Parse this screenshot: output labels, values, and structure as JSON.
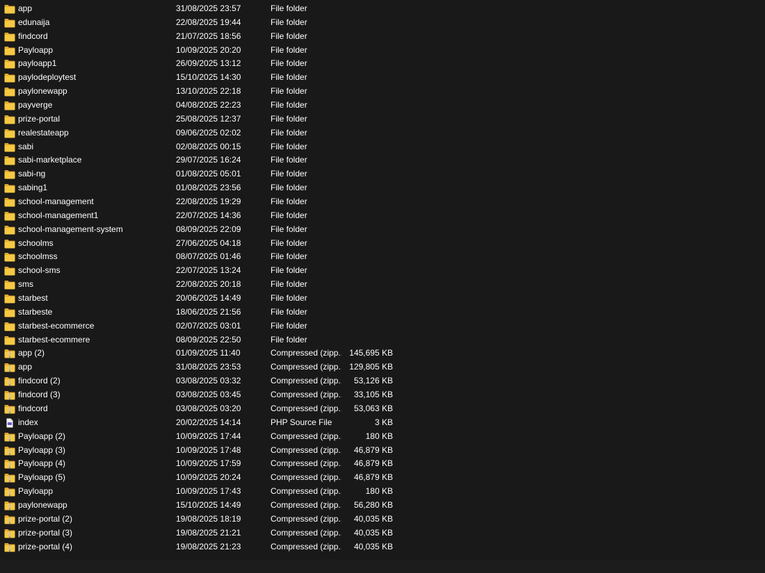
{
  "file_list": {
    "rows": [
      {
        "name": "app",
        "date": "31/08/2025 23:57",
        "type": "File folder",
        "size": "",
        "icon": "folder-icon"
      },
      {
        "name": "edunaija",
        "date": "22/08/2025 19:44",
        "type": "File folder",
        "size": "",
        "icon": "folder-icon"
      },
      {
        "name": "findcord",
        "date": "21/07/2025 18:56",
        "type": "File folder",
        "size": "",
        "icon": "folder-icon"
      },
      {
        "name": "Payloapp",
        "date": "10/09/2025 20:20",
        "type": "File folder",
        "size": "",
        "icon": "folder-icon"
      },
      {
        "name": "payloapp1",
        "date": "26/09/2025 13:12",
        "type": "File folder",
        "size": "",
        "icon": "folder-icon"
      },
      {
        "name": "paylodeploytest",
        "date": "15/10/2025 14:30",
        "type": "File folder",
        "size": "",
        "icon": "folder-icon"
      },
      {
        "name": "paylonewapp",
        "date": "13/10/2025 22:18",
        "type": "File folder",
        "size": "",
        "icon": "folder-icon"
      },
      {
        "name": "payverge",
        "date": "04/08/2025 22:23",
        "type": "File folder",
        "size": "",
        "icon": "folder-icon"
      },
      {
        "name": "prize-portal",
        "date": "25/08/2025 12:37",
        "type": "File folder",
        "size": "",
        "icon": "folder-icon"
      },
      {
        "name": "realestateapp",
        "date": "09/06/2025 02:02",
        "type": "File folder",
        "size": "",
        "icon": "folder-icon"
      },
      {
        "name": "sabi",
        "date": "02/08/2025 00:15",
        "type": "File folder",
        "size": "",
        "icon": "folder-icon"
      },
      {
        "name": "sabi-marketplace",
        "date": "29/07/2025 16:24",
        "type": "File folder",
        "size": "",
        "icon": "folder-icon"
      },
      {
        "name": "sabi-ng",
        "date": "01/08/2025 05:01",
        "type": "File folder",
        "size": "",
        "icon": "folder-icon"
      },
      {
        "name": "sabing1",
        "date": "01/08/2025 23:56",
        "type": "File folder",
        "size": "",
        "icon": "folder-icon"
      },
      {
        "name": "school-management",
        "date": "22/08/2025 19:29",
        "type": "File folder",
        "size": "",
        "icon": "folder-icon"
      },
      {
        "name": "school-management1",
        "date": "22/07/2025 14:36",
        "type": "File folder",
        "size": "",
        "icon": "folder-icon"
      },
      {
        "name": "school-management-system",
        "date": "08/09/2025 22:09",
        "type": "File folder",
        "size": "",
        "icon": "folder-icon"
      },
      {
        "name": "schoolms",
        "date": "27/06/2025 04:18",
        "type": "File folder",
        "size": "",
        "icon": "folder-icon"
      },
      {
        "name": "schoolmss",
        "date": "08/07/2025 01:46",
        "type": "File folder",
        "size": "",
        "icon": "folder-icon"
      },
      {
        "name": "school-sms",
        "date": "22/07/2025 13:24",
        "type": "File folder",
        "size": "",
        "icon": "folder-icon"
      },
      {
        "name": "sms",
        "date": "22/08/2025 20:18",
        "type": "File folder",
        "size": "",
        "icon": "folder-icon"
      },
      {
        "name": "starbest",
        "date": "20/06/2025 14:49",
        "type": "File folder",
        "size": "",
        "icon": "folder-icon"
      },
      {
        "name": "starbeste",
        "date": "18/06/2025 21:56",
        "type": "File folder",
        "size": "",
        "icon": "folder-icon"
      },
      {
        "name": "starbest-ecommerce",
        "date": "02/07/2025 03:01",
        "type": "File folder",
        "size": "",
        "icon": "folder-icon"
      },
      {
        "name": "starbest-ecommere",
        "date": "08/09/2025 22:50",
        "type": "File folder",
        "size": "",
        "icon": "folder-icon"
      },
      {
        "name": "app (2)",
        "date": "01/09/2025 11:40",
        "type": "Compressed (zipp...",
        "size": "145,695 KB",
        "icon": "zip-folder-icon"
      },
      {
        "name": "app",
        "date": "31/08/2025 23:53",
        "type": "Compressed (zipp...",
        "size": "129,805 KB",
        "icon": "zip-folder-icon"
      },
      {
        "name": "findcord (2)",
        "date": "03/08/2025 03:32",
        "type": "Compressed (zipp...",
        "size": "53,126 KB",
        "icon": "zip-folder-icon"
      },
      {
        "name": "findcord (3)",
        "date": "03/08/2025 03:45",
        "type": "Compressed (zipp...",
        "size": "33,105 KB",
        "icon": "zip-folder-icon"
      },
      {
        "name": "findcord",
        "date": "03/08/2025 03:20",
        "type": "Compressed (zipp...",
        "size": "53,063 KB",
        "icon": "zip-folder-icon"
      },
      {
        "name": "index",
        "date": "20/02/2025 14:14",
        "type": "PHP Source File",
        "size": "3 KB",
        "icon": "php-file-icon"
      },
      {
        "name": "Payloapp (2)",
        "date": "10/09/2025 17:44",
        "type": "Compressed (zipp...",
        "size": "180 KB",
        "icon": "zip-folder-icon"
      },
      {
        "name": "Payloapp (3)",
        "date": "10/09/2025 17:48",
        "type": "Compressed (zipp...",
        "size": "46,879 KB",
        "icon": "zip-folder-icon"
      },
      {
        "name": "Payloapp (4)",
        "date": "10/09/2025 17:59",
        "type": "Compressed (zipp...",
        "size": "46,879 KB",
        "icon": "zip-folder-icon"
      },
      {
        "name": "Payloapp (5)",
        "date": "10/09/2025 20:24",
        "type": "Compressed (zipp...",
        "size": "46,879 KB",
        "icon": "zip-folder-icon"
      },
      {
        "name": "Payloapp",
        "date": "10/09/2025 17:43",
        "type": "Compressed (zipp...",
        "size": "180 KB",
        "icon": "zip-folder-icon"
      },
      {
        "name": "paylonewapp",
        "date": "15/10/2025 14:49",
        "type": "Compressed (zipp...",
        "size": "56,280 KB",
        "icon": "zip-folder-icon"
      },
      {
        "name": "prize-portal (2)",
        "date": "19/08/2025 18:19",
        "type": "Compressed (zipp...",
        "size": "40,035 KB",
        "icon": "zip-folder-icon"
      },
      {
        "name": "prize-portal (3)",
        "date": "19/08/2025 21:21",
        "type": "Compressed (zipp...",
        "size": "40,035 KB",
        "icon": "zip-folder-icon"
      },
      {
        "name": "prize-portal (4)",
        "date": "19/08/2025 21:23",
        "type": "Compressed (zipp...",
        "size": "40,035 KB",
        "icon": "zip-folder-icon"
      }
    ]
  },
  "colors": {
    "background": "#191919",
    "text": "#ffffff",
    "folder": "#f6c942",
    "folder_dark": "#e0a82e"
  }
}
